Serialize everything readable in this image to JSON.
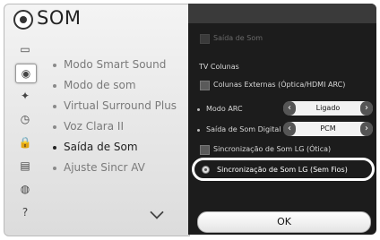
{
  "window": {
    "title": "SOM",
    "title_icon": "speaker-icon"
  },
  "side_icons": [
    {
      "name": "picture-icon",
      "glyph": "▭",
      "selected": false
    },
    {
      "name": "audio-icon",
      "glyph": "◉",
      "selected": true
    },
    {
      "name": "channel-icon",
      "glyph": "✦",
      "selected": false
    },
    {
      "name": "clock-icon",
      "glyph": "◷",
      "selected": false
    },
    {
      "name": "lock-icon",
      "glyph": "🔒",
      "selected": false
    },
    {
      "name": "option-icon",
      "glyph": "▤",
      "selected": false
    },
    {
      "name": "network-icon",
      "glyph": "◍",
      "selected": false
    },
    {
      "name": "help-icon",
      "glyph": "?",
      "selected": false
    }
  ],
  "menu": {
    "items": [
      {
        "label": "Modo Smart Sound"
      },
      {
        "label": "Modo de som"
      },
      {
        "label": "Virtual Surround Plus"
      },
      {
        "label": "Voz Clara II"
      },
      {
        "label": "Saída de Som",
        "active": true
      },
      {
        "label": "Ajuste Sincr AV"
      }
    ],
    "more_icon": "chevron-down-icon"
  },
  "panel": {
    "saida_de_som": "Saída de Som",
    "tv_colunas": "TV Colunas",
    "colunas_externas": "Colunas Externas (Óptica/HDMI ARC)",
    "modo_arc": {
      "label": "Modo ARC",
      "value": "Ligado"
    },
    "saida_digital": {
      "label": "Saída de Som Digital",
      "value": "PCM"
    },
    "sinc_otica": "Sincronização de Som LG (Ótica)",
    "sinc_sem_fios": "Sincronização de Som LG (Sem Fios)",
    "ok_label": "OK"
  }
}
